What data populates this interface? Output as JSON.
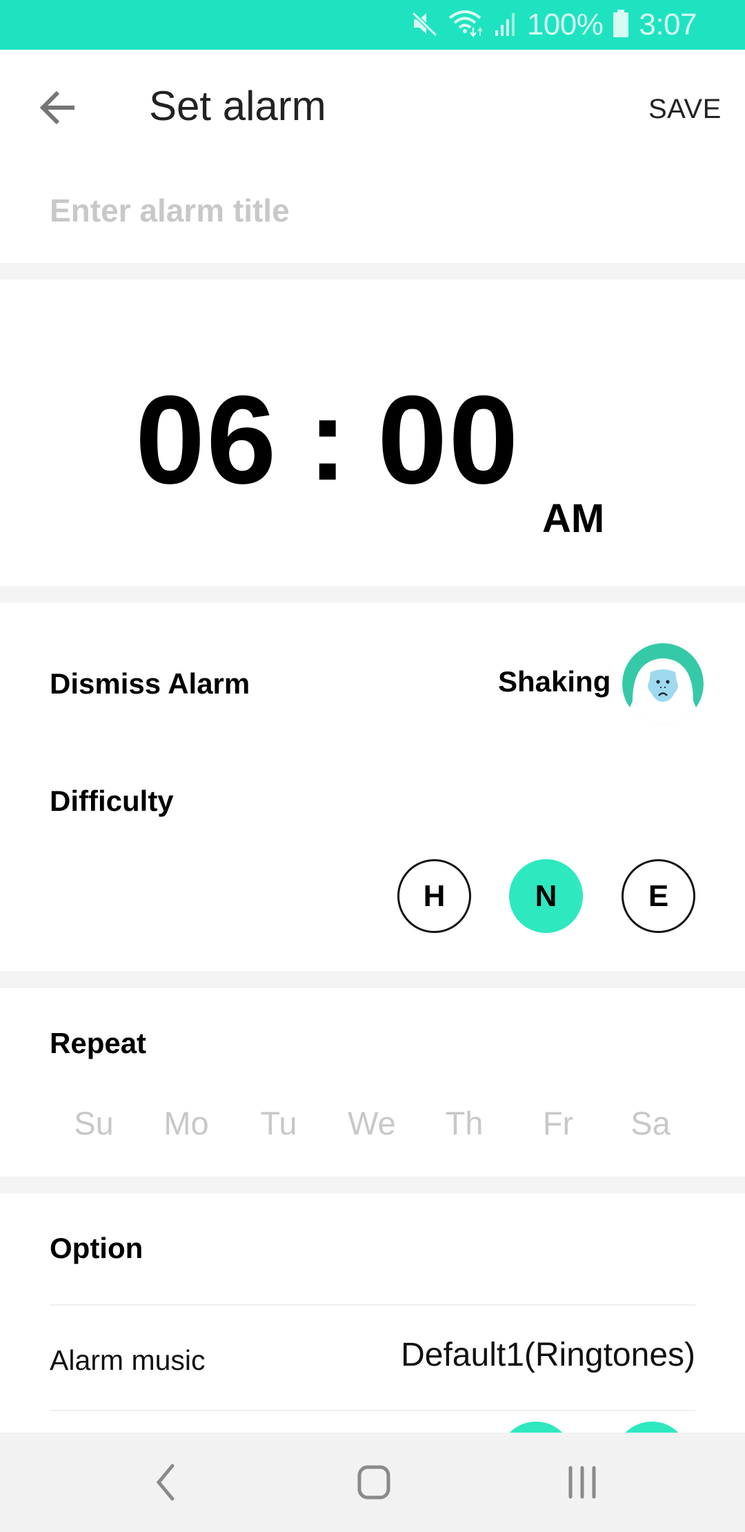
{
  "status_bar": {
    "battery_percent": "100%",
    "time": "3:07",
    "icons": [
      "mute-icon",
      "wifi-icon",
      "signal-icon",
      "battery-icon"
    ]
  },
  "header": {
    "back_icon": "arrow-left-icon",
    "title": "Set alarm",
    "save_label": "SAVE"
  },
  "alarm_title": {
    "value": "",
    "placeholder": "Enter alarm title"
  },
  "time": {
    "hour": "06",
    "separator": ":",
    "minute": "00",
    "period": "AM"
  },
  "dismiss": {
    "label": "Dismiss Alarm",
    "value": "Shaking",
    "avatar_icon": "gorilla-icon"
  },
  "difficulty": {
    "label": "Difficulty",
    "options": [
      {
        "label": "H",
        "selected": false
      },
      {
        "label": "N",
        "selected": true
      },
      {
        "label": "E",
        "selected": false
      }
    ]
  },
  "repeat": {
    "label": "Repeat",
    "days": [
      {
        "label": "Su",
        "selected": false
      },
      {
        "label": "Mo",
        "selected": false
      },
      {
        "label": "Tu",
        "selected": false
      },
      {
        "label": "We",
        "selected": false
      },
      {
        "label": "Th",
        "selected": false
      },
      {
        "label": "Fr",
        "selected": false
      },
      {
        "label": "Sa",
        "selected": false
      }
    ]
  },
  "option": {
    "label": "Option",
    "rows": [
      {
        "label": "Alarm music",
        "value": "Default1(Ringtones)"
      }
    ]
  },
  "nav_bar": {
    "icons": [
      "back-nav-icon",
      "home-nav-icon",
      "recents-nav-icon"
    ]
  },
  "colors": {
    "accent": "#2ee8c0",
    "status_bar": "#1fe3c0",
    "placeholder": "#c8c8c8",
    "section_band": "#f4f4f4"
  }
}
